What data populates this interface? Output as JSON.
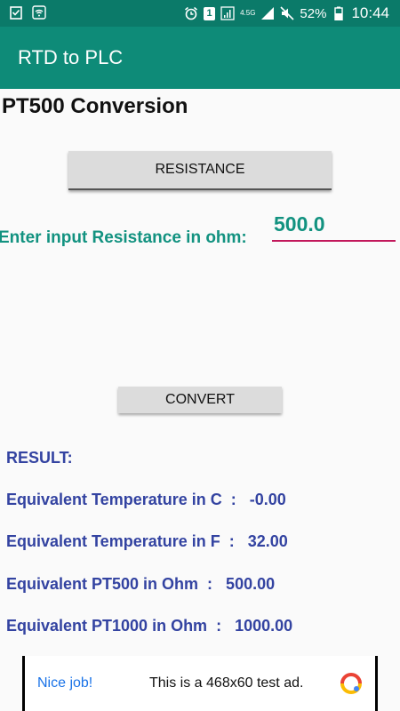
{
  "status_bar": {
    "battery_percent": "52%",
    "time": "10:44",
    "network_label": "4.5G",
    "notification_badge": "1",
    "icons": [
      "clipboard-check-icon",
      "wifi-icon",
      "alarm-icon",
      "notification-badge-icon",
      "phone-signal-icon",
      "network-icon",
      "signal-icon",
      "mute-icon",
      "battery-icon"
    ]
  },
  "app_bar": {
    "title": "RTD to PLC"
  },
  "page": {
    "title": "PT500 Conversion"
  },
  "buttons": {
    "resistance": "RESISTANCE",
    "convert": "CONVERT"
  },
  "input": {
    "label": "Enter input Resistance  in ohm:",
    "value": "500.0"
  },
  "results": {
    "heading": "RESULT:",
    "lines": [
      "Equivalent Temperature in C  :   -0.00",
      "Equivalent Temperature in F  :   32.00",
      "Equivalent PT500 in Ohm  :   500.00",
      "Equivalent PT1000 in Ohm  :   1000.00"
    ]
  },
  "ad": {
    "left": "Nice job!",
    "text": "This is a 468x60 test ad."
  },
  "colors": {
    "status_bar": "#0b7a69",
    "app_bar": "#0e8b78",
    "input_accent": "#129280",
    "underline": "#c2185b",
    "result_text": "#3343a1"
  }
}
